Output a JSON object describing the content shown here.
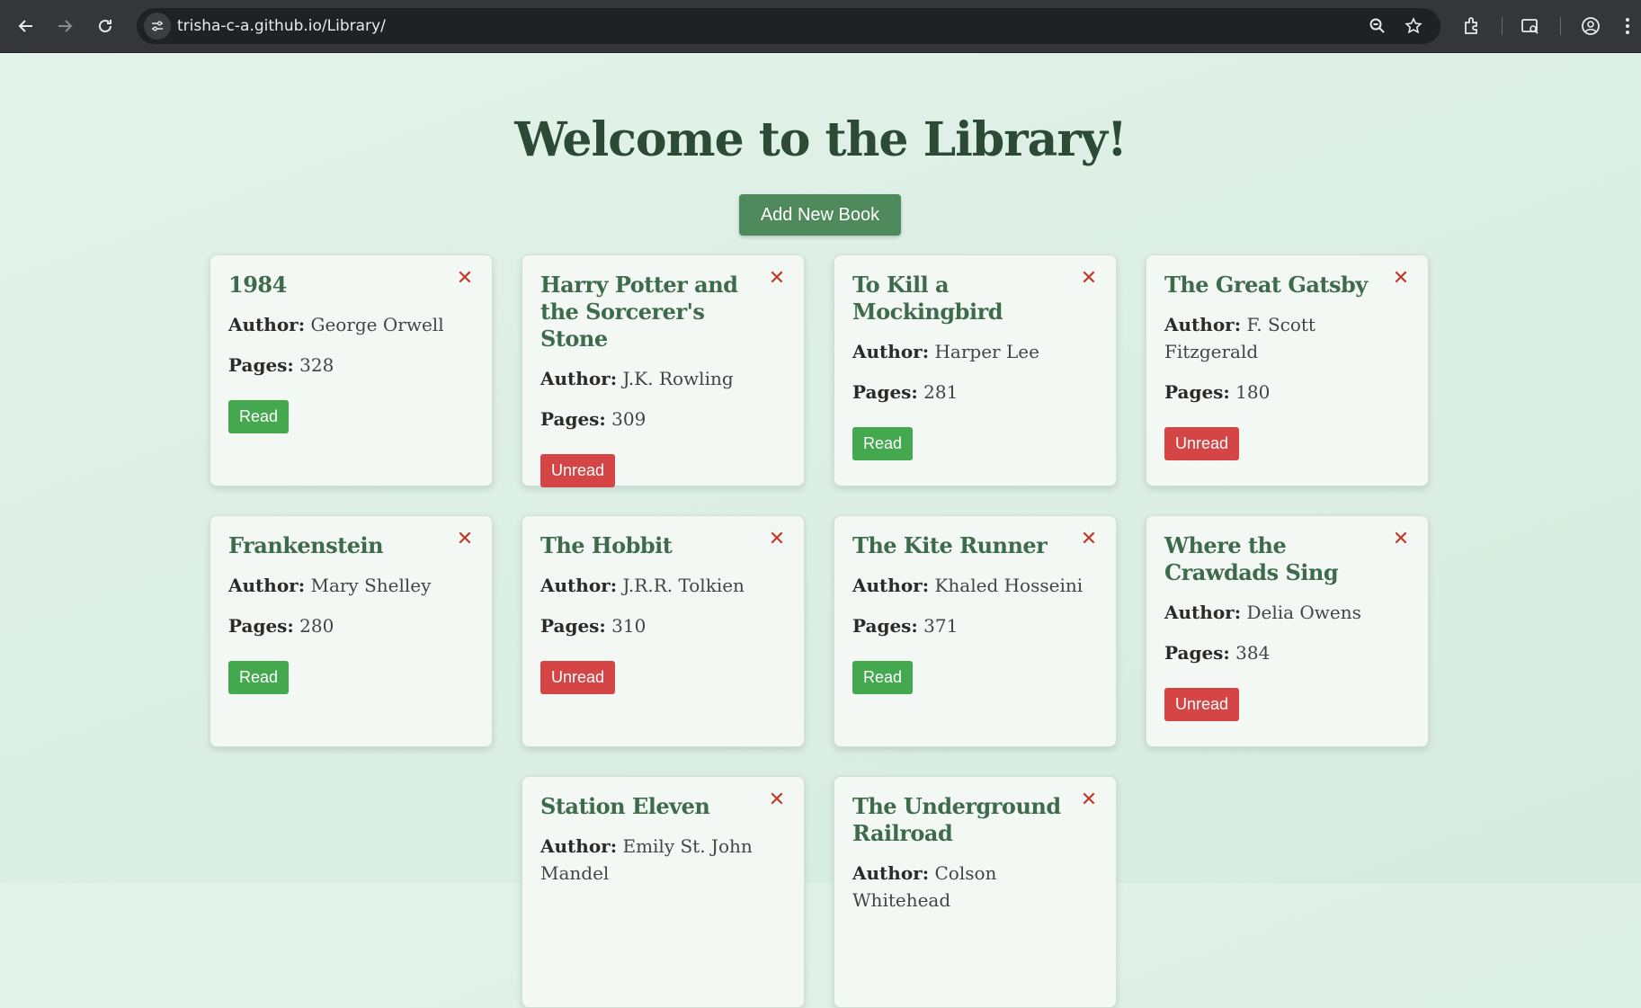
{
  "browser": {
    "url": "trisha-c-a.github.io/Library/"
  },
  "page": {
    "title": "Welcome to the Library!",
    "add_button_label": "Add New Book",
    "author_label": "Author:",
    "pages_label": "Pages:",
    "delete_symbol": "✕"
  },
  "books": [
    {
      "title": "1984",
      "author": "George Orwell",
      "pages": "328",
      "status": "Read"
    },
    {
      "title": "Harry Potter and the Sorcerer's Stone",
      "author": "J.K. Rowling",
      "pages": "309",
      "status": "Unread"
    },
    {
      "title": "To Kill a Mockingbird",
      "author": "Harper Lee",
      "pages": "281",
      "status": "Read"
    },
    {
      "title": "The Great Gatsby",
      "author": "F. Scott Fitzgerald",
      "pages": "180",
      "status": "Unread"
    },
    {
      "title": "Frankenstein",
      "author": "Mary Shelley",
      "pages": "280",
      "status": "Read"
    },
    {
      "title": "The Hobbit",
      "author": "J.R.R. Tolkien",
      "pages": "310",
      "status": "Unread"
    },
    {
      "title": "The Kite Runner",
      "author": "Khaled Hosseini",
      "pages": "371",
      "status": "Read"
    },
    {
      "title": "Where the Crawdads Sing",
      "author": "Delia Owens",
      "pages": "384",
      "status": "Unread"
    },
    {
      "title": "Station Eleven",
      "author": "Emily St. John Mandel",
      "pages": "",
      "status": ""
    },
    {
      "title": "The Underground Railroad",
      "author": "Colson Whitehead",
      "pages": "",
      "status": ""
    }
  ],
  "colors": {
    "read": "#43a84e",
    "unread": "#d64545",
    "accent": "#4f8a5c",
    "title_text": "#2d4a37"
  }
}
